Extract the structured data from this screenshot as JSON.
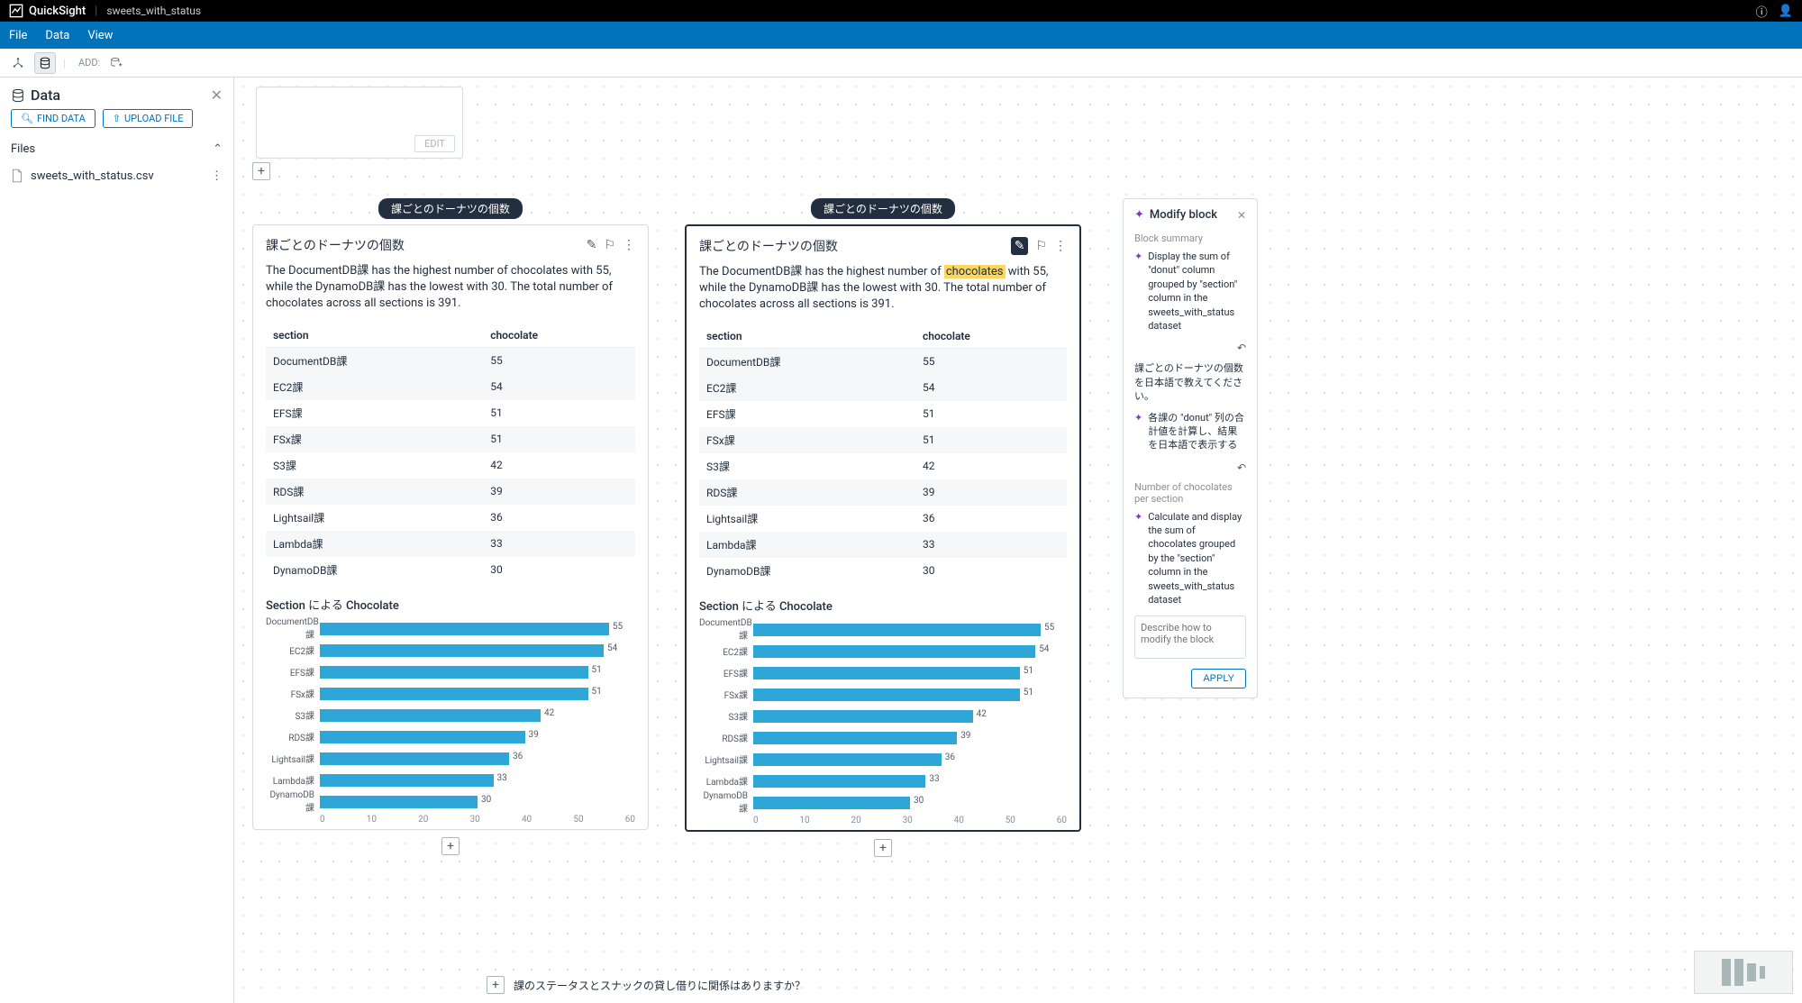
{
  "app": {
    "name": "QuickSight",
    "doc": "sweets_with_status"
  },
  "menu": {
    "file": "File",
    "data": "Data",
    "view": "View"
  },
  "toolbar": {
    "add_label": "ADD:"
  },
  "sidebar": {
    "title": "Data",
    "find": "FIND DATA",
    "upload": "UPLOAD FILE",
    "files_label": "Files",
    "file_name": "sweets_with_status.csv"
  },
  "empty_block": {
    "edit": "EDIT"
  },
  "block_tag": "課ごとのドーナツの個数",
  "block": {
    "title": "課ごとのドーナツの個数",
    "summary_pre": "The DocumentDB課 has the highest number of ",
    "summary_hl": "chocolates",
    "summary_post": " with 55, while the DynamoDB課 has the lowest with 30. The total number of chocolates across all sections is 391.",
    "summary_full": "The DocumentDB課 has the highest number of chocolates with 55, while the DynamoDB課 has the lowest with 30. The total number of chocolates across all sections is 391.",
    "col1": "section",
    "col2": "chocolate",
    "chart_title": "Section による Chocolate"
  },
  "chart_data": {
    "type": "bar",
    "orientation": "horizontal",
    "title": "Section による Chocolate",
    "xlabel": "",
    "ylabel": "",
    "xlim": [
      0,
      60
    ],
    "ticks": [
      0,
      10,
      20,
      30,
      40,
      50,
      60
    ],
    "categories": [
      "DocumentDB課",
      "EC2課",
      "EFS課",
      "FSx課",
      "S3課",
      "RDS課",
      "Lightsail課",
      "Lambda課",
      "DynamoDB課"
    ],
    "values": [
      55,
      54,
      51,
      51,
      42,
      39,
      36,
      33,
      30
    ]
  },
  "modify": {
    "title": "Modify block",
    "summary_label": "Block summary",
    "item1": "Display the sum of \"donut\" column grouped by \"section\" column in the sweets_with_status dataset",
    "q1": "課ごとのドーナツの個数を日本語で教えてください。",
    "item2": "各課の \"donut\" 列の合計値を計算し、結果を日本語で表示する",
    "q2": "Number of chocolates per section",
    "item3": "Calculate and display the sum of chocolates grouped by the \"section\" column in the sweets_with_status dataset",
    "placeholder": "Describe how to modify the block",
    "apply": "APPLY"
  },
  "footer_hint": "課のステータスとスナックの貸し借りに関係はありますか？"
}
